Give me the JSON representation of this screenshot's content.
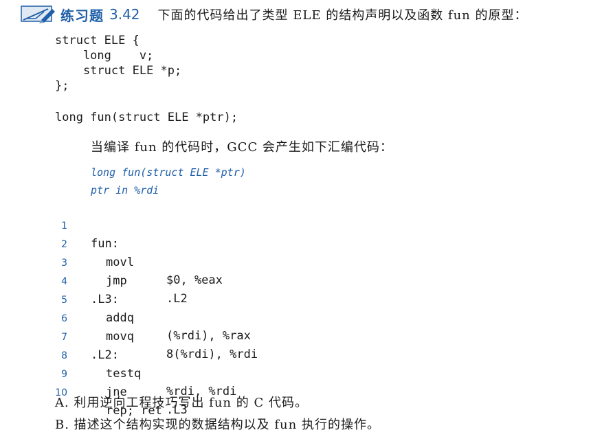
{
  "exercise": {
    "label": "练习题",
    "number": "3.42",
    "text": "下面的代码给出了类型 ELE 的结构声明以及函数 fun 的原型："
  },
  "struct_decl": [
    "struct ELE {",
    "    long    v;",
    "    struct ELE *p;",
    "};"
  ],
  "prototype": "long fun(struct ELE *ptr);",
  "intro": "当编译 fun 的代码时，GCC 会产生如下汇编代码：",
  "asm_comments": [
    "long fun(struct ELE *ptr)",
    "ptr in %rdi"
  ],
  "asm_lines": [
    {
      "num": "1",
      "label": "fun:",
      "op": "",
      "args": ""
    },
    {
      "num": "2",
      "label": "",
      "op": "movl",
      "args": "$0, %eax"
    },
    {
      "num": "3",
      "label": "",
      "op": "jmp",
      "args": ".L2"
    },
    {
      "num": "4",
      "label": ".L3:",
      "op": "",
      "args": ""
    },
    {
      "num": "5",
      "label": "",
      "op": "addq",
      "args": "(%rdi), %rax"
    },
    {
      "num": "6",
      "label": "",
      "op": "movq",
      "args": "8(%rdi), %rdi"
    },
    {
      "num": "7",
      "label": ".L2:",
      "op": "",
      "args": ""
    },
    {
      "num": "8",
      "label": "",
      "op": "testq",
      "args": "%rdi, %rdi"
    },
    {
      "num": "9",
      "label": "",
      "op": "jne",
      "args": ".L3"
    },
    {
      "num": "10",
      "label": "",
      "op": "rep; ret",
      "args": ""
    }
  ],
  "questions": [
    "A. 利用逆向工程技巧写出 fun 的 C 代码。",
    "B. 描述这个结构实现的数据结构以及 fun 执行的操作。"
  ],
  "colors": {
    "accent": "#1f5fa8",
    "text": "#1a1a1a"
  },
  "icons": {
    "exercise": "exercise-pencil-icon"
  }
}
